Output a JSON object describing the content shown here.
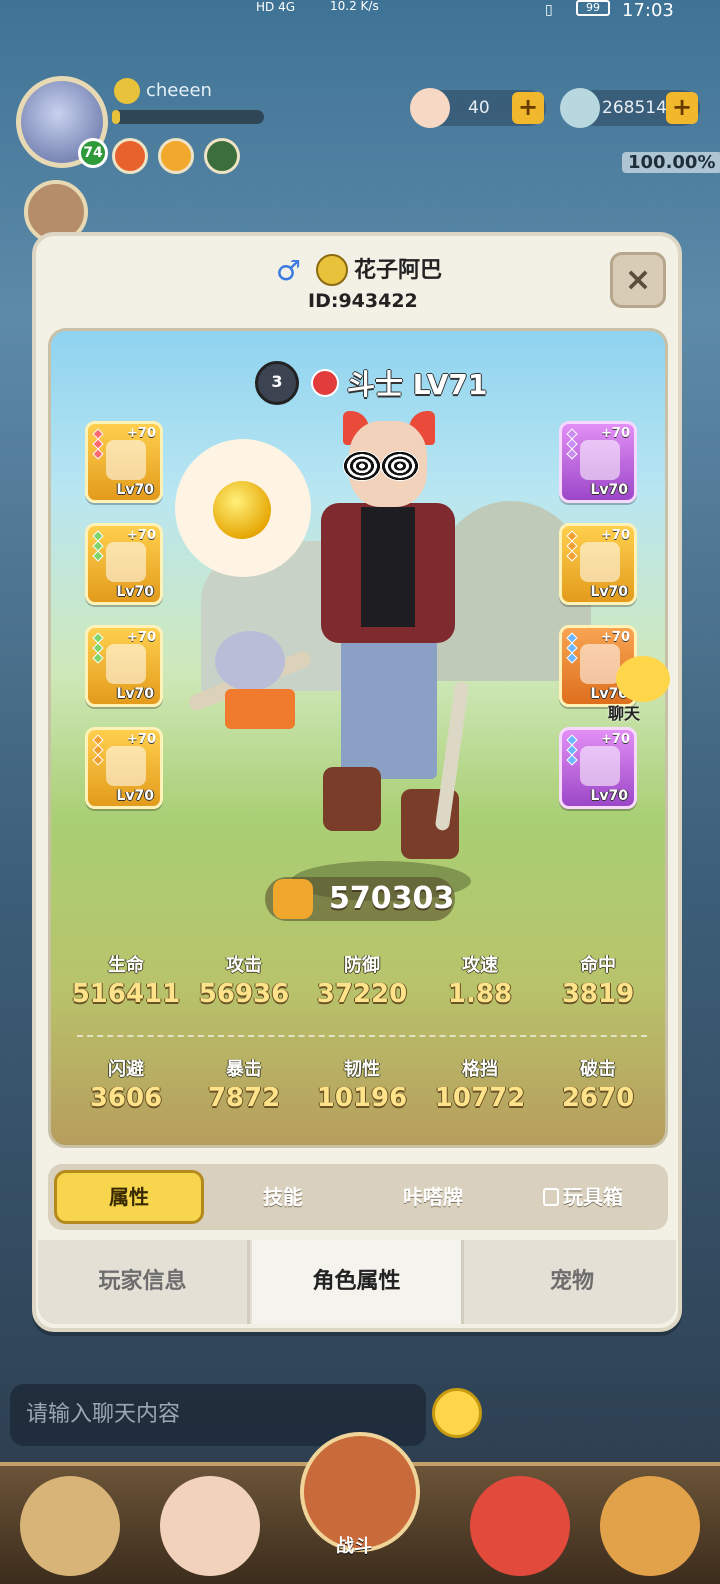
{
  "status_bar": {
    "network": "HD 4G",
    "speed": "10.2 K/s",
    "battery": "99",
    "time": "17:03"
  },
  "hud": {
    "player_name": "cheeen",
    "level": "74",
    "currency_1": "40",
    "currency_2": "268514",
    "completion": "100.00%"
  },
  "profile": {
    "name": "花子阿巴",
    "id": "ID:943422",
    "rank": "3",
    "class_label": "斗士 LV71",
    "power": "570303",
    "close": "×"
  },
  "equipment_left": [
    {
      "plus": "+70",
      "lv": "Lv70"
    },
    {
      "plus": "+70",
      "lv": "Lv70"
    },
    {
      "plus": "+70",
      "lv": "Lv70"
    },
    {
      "plus": "+70",
      "lv": "Lv70"
    }
  ],
  "equipment_right": [
    {
      "plus": "+70",
      "lv": "Lv70",
      "rarity": "purple"
    },
    {
      "plus": "+70",
      "lv": "Lv70",
      "rarity": "gold"
    },
    {
      "plus": "+70",
      "lv": "Lv70",
      "rarity": "gold"
    },
    {
      "plus": "+70",
      "lv": "Lv70",
      "rarity": "purple"
    }
  ],
  "stats": {
    "row1": [
      {
        "label": "生命",
        "value": "516411"
      },
      {
        "label": "攻击",
        "value": "56936"
      },
      {
        "label": "防御",
        "value": "37220"
      },
      {
        "label": "攻速",
        "value": "1.88"
      },
      {
        "label": "命中",
        "value": "3819"
      }
    ],
    "row2": [
      {
        "label": "闪避",
        "value": "3606"
      },
      {
        "label": "暴击",
        "value": "7872"
      },
      {
        "label": "韧性",
        "value": "10196"
      },
      {
        "label": "格挡",
        "value": "10772"
      },
      {
        "label": "破击",
        "value": "2670"
      }
    ]
  },
  "sub_tabs": [
    "属性",
    "技能",
    "咔嗒牌",
    "玩具箱"
  ],
  "main_tabs": [
    "玩家信息",
    "角色属性",
    "宠物"
  ],
  "chat": {
    "label": "聊天",
    "placeholder": "请输入聊天内容"
  },
  "bottom_nav": {
    "battle": "战斗"
  },
  "icons": {
    "gender": "male-icon",
    "lock": "lock-icon",
    "power": "muscle-icon"
  },
  "colors": {
    "gold_item": "#ffcf4d",
    "purple_item": "#e28ff5",
    "stat_value": "#ffe38a",
    "active_tab": "#f7d54c"
  }
}
